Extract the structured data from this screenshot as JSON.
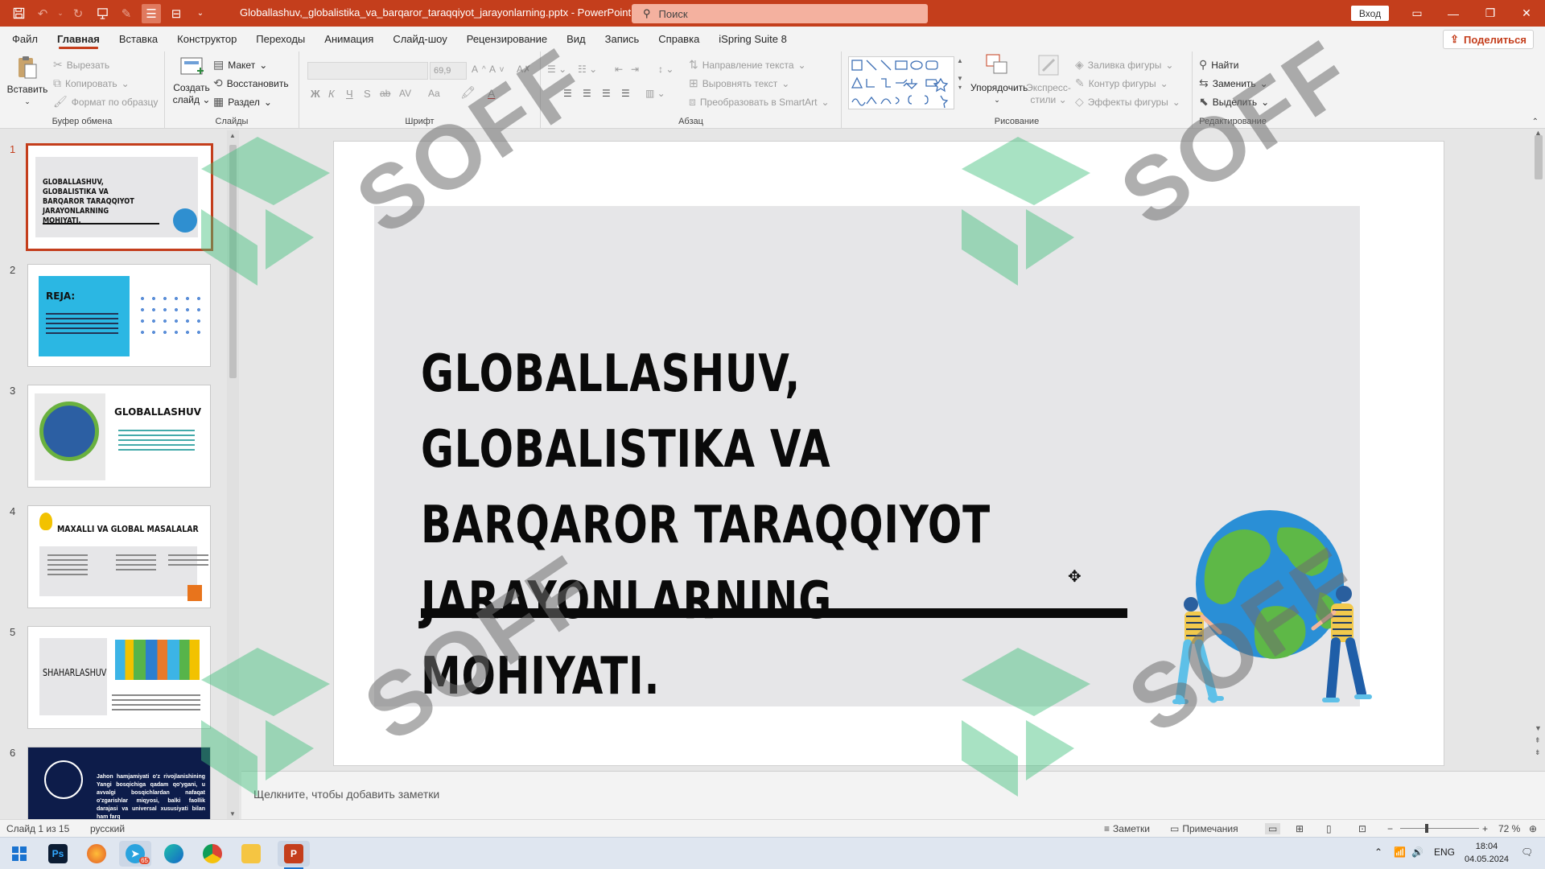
{
  "titlebar": {
    "title": "Globallashuv,_globalistika_va_barqaror_taraqqiyot_jarayonlarning.pptx",
    "separator": "-",
    "app": "PowerPoint",
    "search_placeholder": "Поиск",
    "signin": "Вход"
  },
  "menu": {
    "tabs": [
      "Файл",
      "Главная",
      "Вставка",
      "Конструктор",
      "Переходы",
      "Анимация",
      "Слайд-шоу",
      "Рецензирование",
      "Вид",
      "Запись",
      "Справка",
      "iSpring Suite 8"
    ],
    "share": "Поделиться"
  },
  "ribbon": {
    "clipboard": {
      "paste": "Вставить",
      "cut": "Вырезать",
      "copy": "Копировать",
      "format_painter": "Формат по образцу",
      "label": "Буфер обмена"
    },
    "slides": {
      "new_slide_line1": "Создать",
      "new_slide_line2": "слайд",
      "layout": "Макет",
      "reset": "Восстановить",
      "section": "Раздел",
      "label": "Слайды"
    },
    "font": {
      "size": "69,9",
      "label": "Шрифт",
      "bold": "Ж",
      "italic": "К",
      "underline": "Ч",
      "strike": "S",
      "ab": "ab",
      "av": "AV",
      "aa": "Aa"
    },
    "paragraph": {
      "text_direction": "Направление текста",
      "align_text": "Выровнять текст",
      "smartart": "Преобразовать в SmartArt",
      "label": "Абзац"
    },
    "drawing": {
      "arrange": "Упорядочить",
      "quick_styles_line1": "Экспресс-",
      "quick_styles_line2": "стили",
      "shape_fill": "Заливка фигуры",
      "shape_outline": "Контур фигуры",
      "shape_effects": "Эффекты фигуры",
      "label": "Рисование"
    },
    "editing": {
      "find": "Найти",
      "replace": "Заменить",
      "select": "Выделить",
      "label": "Редактирование"
    }
  },
  "slides_panel": {
    "items": [
      {
        "num": "1",
        "title": "GLOBALLASHUV, GLOBALISTIKA VA BARQAROR TARAQQIYOT JARAYONLARNING MOHIYATI."
      },
      {
        "num": "2",
        "title": "REJA:"
      },
      {
        "num": "3",
        "title": "GLOBALLASHUV"
      },
      {
        "num": "4",
        "title": "MAXALLI VA GLOBAL MASALALAR"
      },
      {
        "num": "5",
        "title": "SHAHARLASHUV"
      },
      {
        "num": "6",
        "title": "Jahon hamjamiyati o'z rivojlanishining Yangi bosqichiga qadam qo'ygani, u avvalgi bosqichlardan nafaqat o'zgarishlar miqyosi, balki faollik darajasi va universal xususiyati bilan ham farq"
      }
    ]
  },
  "slide": {
    "title_lines": [
      "GLOBALLASHUV, GLOBALISTIKA VA",
      "BARQAROR TARAQQIYOT",
      "JARAYONLARNING MOHIYATI."
    ]
  },
  "notes": {
    "placeholder": "Щелкните, чтобы добавить заметки"
  },
  "status": {
    "slide_of": "Слайд 1 из 15",
    "language": "русский",
    "notes": "Заметки",
    "comments": "Примечания",
    "zoom": "72 %"
  },
  "taskbar": {
    "lang": "ENG",
    "time": "18:04",
    "date": "04.05.2024",
    "telegram_badge": "65"
  },
  "watermark": {
    "text": "SOFF"
  },
  "colors": {
    "accent": "#c43e1c",
    "watermark_green": "#3dbf7a"
  }
}
